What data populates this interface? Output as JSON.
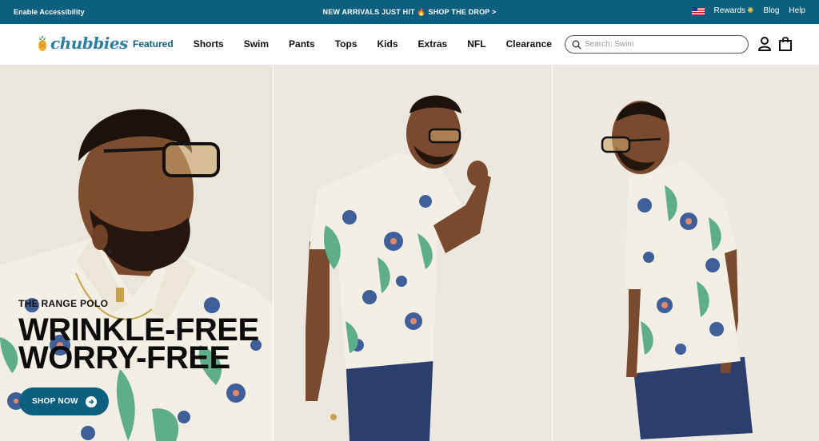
{
  "topbar": {
    "accessibility": "Enable Accessibility",
    "promo": "NEW ARRIVALS JUST HIT 🔥 SHOP THE DROP >",
    "rewards": "Rewards",
    "blog": "Blog",
    "help": "Help"
  },
  "brand": {
    "name": "chubbies"
  },
  "nav": {
    "items": [
      {
        "label": "Featured",
        "active": true
      },
      {
        "label": "Shorts"
      },
      {
        "label": "Swim"
      },
      {
        "label": "Pants"
      },
      {
        "label": "Tops"
      },
      {
        "label": "Kids"
      },
      {
        "label": "Extras"
      },
      {
        "label": "NFL"
      },
      {
        "label": "Clearance"
      }
    ]
  },
  "search": {
    "placeholder": "Search: Swim",
    "icon": "search-icon"
  },
  "icons": {
    "account": "user-icon",
    "cart": "shopping-bag-icon",
    "region": "us-flag-icon"
  },
  "hero": {
    "eyebrow": "THE RANGE POLO",
    "headline_line1": "WRINKLE-FREE",
    "headline_line2": "WORRY-FREE",
    "cta": "SHOP NOW"
  },
  "colors": {
    "primary": "#0d5f80",
    "brand_logo": "#2a7fa3",
    "pants": "#2c3e6b",
    "shirt": "#f3efe4"
  }
}
